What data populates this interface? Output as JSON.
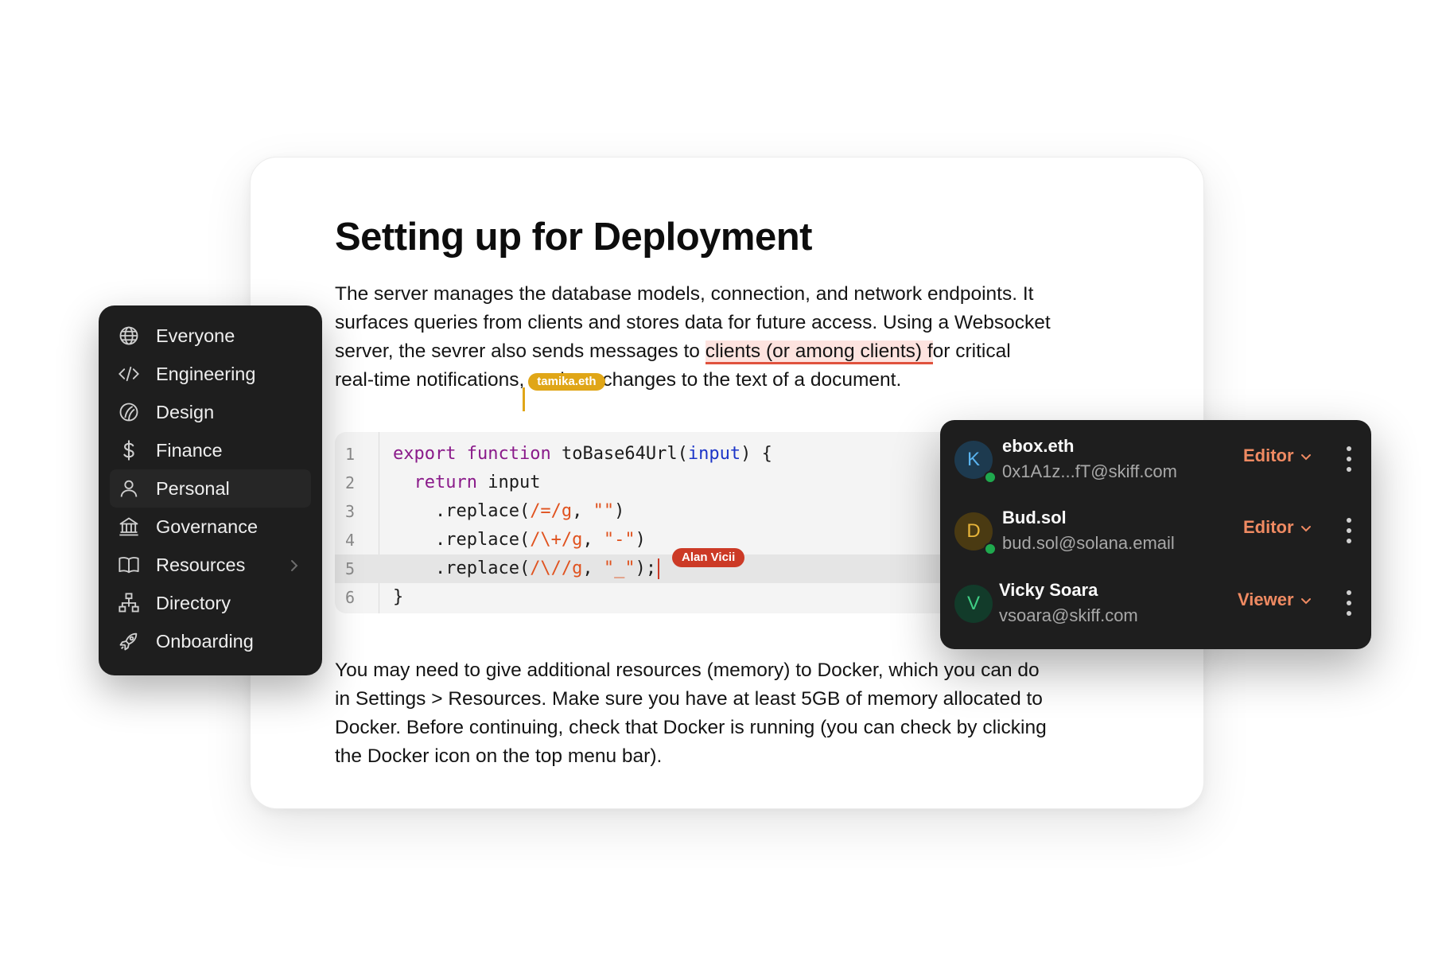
{
  "document": {
    "title": "Setting up for Deployment",
    "para1": {
      "line1": "The server manages the database models, connection, and network endpoints. It",
      "line2": "surfaces queries from clients and stores data for future access. Using a Websocket",
      "line3_before": "server, the sevrer also sends messages to ",
      "line3_highlight": "clients (or among clients) f",
      "line3_after": "or critical",
      "line4_before": "real-time notifications,",
      "line4_after": " such as changes to the text of a document."
    },
    "para2": {
      "line1": "You may need to give additional resources (memory) to Docker, which you can do",
      "line2": "in Settings > Resources. Make sure you have at least 5GB of memory allocated to",
      "line3": "Docker. Before continuing, check that Docker is running (you can check by clicking",
      "line4": "the Docker icon on the top menu bar)."
    },
    "collaborator_cursor": {
      "label": "tamika.eth",
      "color": "#e0a617"
    }
  },
  "code": {
    "line_numbers": [
      "1",
      "2",
      "3",
      "4",
      "5",
      "6"
    ],
    "active_line": 5,
    "lines": {
      "l1": {
        "kw1": "export",
        "kw2": "function",
        "name": "toBase64Url(",
        "param": "input",
        "end": ") {"
      },
      "l2": {
        "indent": "  ",
        "kw": "return",
        "rest": " input"
      },
      "l3": {
        "pre": "    .replace(",
        "regex": "/=/g",
        "mid": ", ",
        "str": "\"\"",
        "end": ")"
      },
      "l4": {
        "pre": "    .replace(",
        "regex": "/\\+/g",
        "mid": ", ",
        "str": "\"-\"",
        "end": ")"
      },
      "l5": {
        "pre": "    .replace(",
        "regex": "/\\//g",
        "mid": ", ",
        "str": "\"_\"",
        "end": ");"
      },
      "l6": {
        "text": "}"
      }
    },
    "collaborator_cursor": {
      "label": "Alan Vicii",
      "color": "#cc3a26"
    }
  },
  "sidebar": {
    "items": [
      {
        "label": "Everyone",
        "icon": "globe-icon"
      },
      {
        "label": "Engineering",
        "icon": "code-icon"
      },
      {
        "label": "Design",
        "icon": "design-icon"
      },
      {
        "label": "Finance",
        "icon": "dollar-icon"
      },
      {
        "label": "Personal",
        "icon": "user-icon",
        "selected": true
      },
      {
        "label": "Governance",
        "icon": "bank-icon"
      },
      {
        "label": "Resources",
        "icon": "book-icon",
        "has_submenu": true
      },
      {
        "label": "Directory",
        "icon": "hierarchy-icon"
      },
      {
        "label": "Onboarding",
        "icon": "rocket-icon"
      }
    ]
  },
  "share_panel": {
    "users": [
      {
        "initial": "K",
        "name": "ebox.eth",
        "email": "0x1A1z...fT@skiff.com",
        "role": "Editor",
        "online": true,
        "avatar_bg": "#1d3a4f",
        "avatar_fg": "#5ab4f0"
      },
      {
        "initial": "D",
        "name": "Bud.sol",
        "email": "bud.sol@solana.email",
        "role": "Editor",
        "online": true,
        "avatar_bg": "#4a3a12",
        "avatar_fg": "#e8b53a"
      },
      {
        "initial": "V",
        "name": "Vicky Soara",
        "email": "vsoara@skiff.com",
        "role": "Viewer",
        "online": false,
        "avatar_bg": "#123b2a",
        "avatar_fg": "#3fcf85"
      }
    ],
    "role_color": "#ef8a62"
  }
}
